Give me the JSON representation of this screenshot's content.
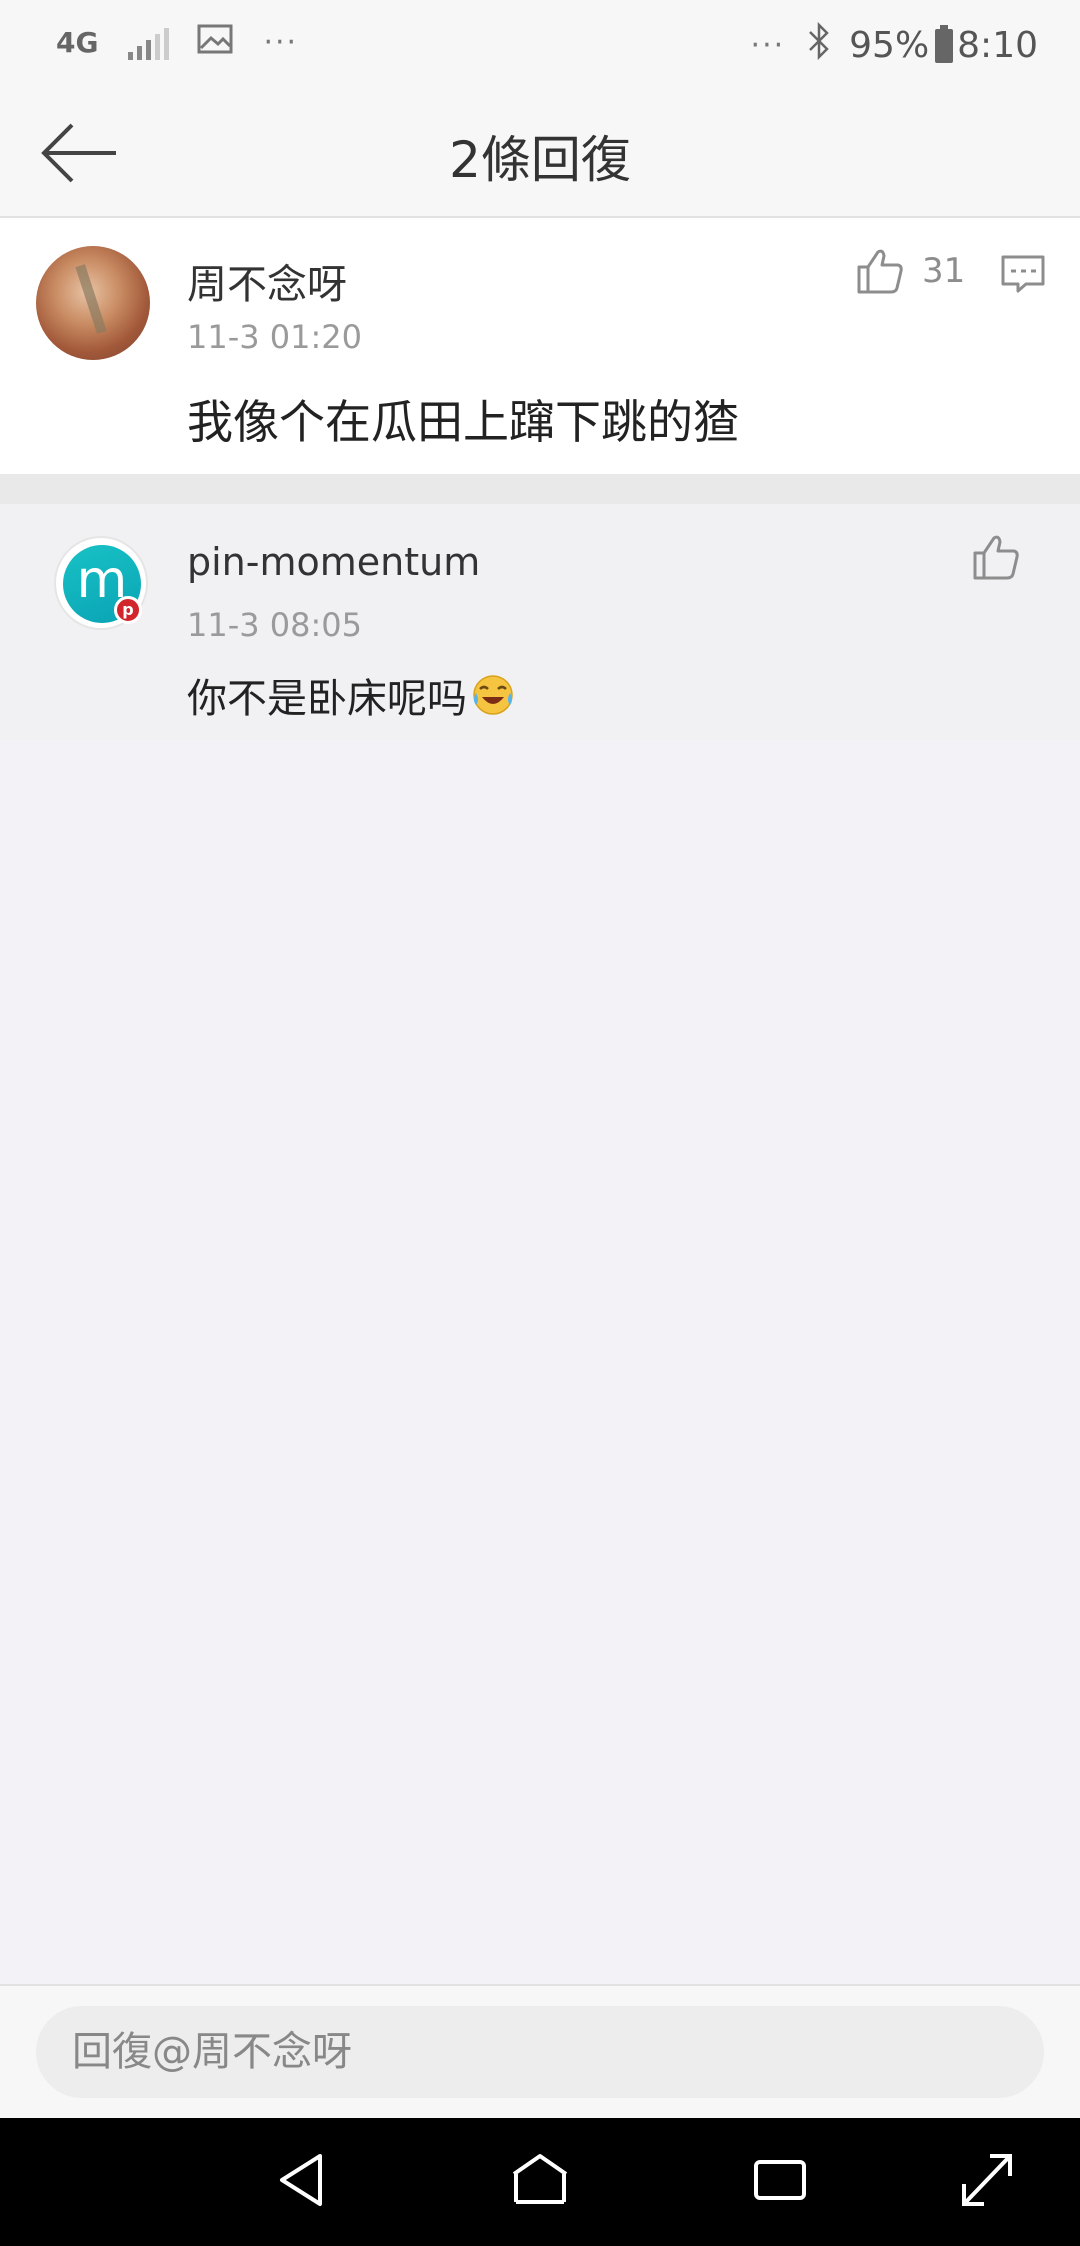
{
  "status_bar": {
    "network": "4G",
    "left_dots": "···",
    "right_dots": "···",
    "battery": "95%",
    "time": "8:10"
  },
  "header": {
    "title": "2條回復"
  },
  "main_comment": {
    "author": "周不念呀",
    "time": "11-3 01:20",
    "text": "我像个在瓜田上蹿下跳的猹",
    "likes": "31"
  },
  "reply": {
    "author": "pin-momentum",
    "avatar_letter": "m",
    "badge_letter": "p",
    "time": "11-3 08:05",
    "text": "你不是卧床呢吗"
  },
  "reply_bar": {
    "placeholder": "回復@周不念呀"
  },
  "icons": {
    "back": "back-arrow-icon",
    "like": "thumbs-up-icon",
    "comment": "comment-icon",
    "emoji": "laughing-crying-emoji",
    "nav": [
      "back-triangle-icon",
      "home-icon",
      "recent-apps-icon",
      "expand-icon"
    ]
  },
  "colors": {
    "avatar_teal": "#18c2c5",
    "pin_red": "#d1272c",
    "nav_background": "#000000"
  }
}
